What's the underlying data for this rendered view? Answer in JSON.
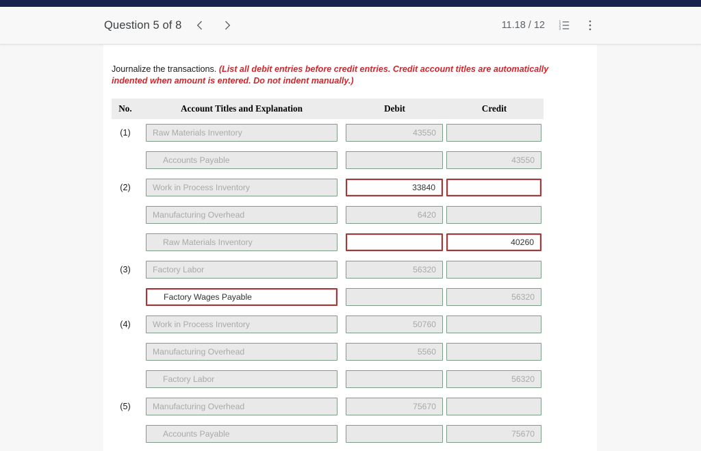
{
  "toolbar": {
    "question_label": "Question 5 of 8",
    "prev_icon": "chevron-left-icon",
    "next_icon": "chevron-right-icon",
    "score": "11.18 / 12",
    "list_icon": "numbered-list-icon",
    "more_icon": "more-vertical-icon"
  },
  "instructions": {
    "plain": "Journalize the transactions.",
    "emphasis": "(List all debit entries before credit entries. Credit account titles are automatically indented when amount is entered. Do not indent manually.)"
  },
  "table": {
    "headers": {
      "no": "No.",
      "account": "Account Titles and Explanation",
      "debit": "Debit",
      "credit": "Credit"
    },
    "rows": [
      {
        "no": "(1)",
        "lines": [
          {
            "account": "Raw Materials Inventory",
            "indent": false,
            "account_state": "disabled",
            "debit": "43550",
            "debit_state": "disabled",
            "credit": "",
            "credit_state": "disabled"
          },
          {
            "account": "Accounts Payable",
            "indent": true,
            "account_state": "disabled",
            "debit": "",
            "debit_state": "disabled",
            "credit": "43550",
            "credit_state": "disabled"
          }
        ]
      },
      {
        "no": "(2)",
        "lines": [
          {
            "account": "Work in Process Inventory",
            "indent": false,
            "account_state": "disabled",
            "debit": "33840",
            "debit_state": "active",
            "credit": "",
            "credit_state": "active"
          },
          {
            "account": "Manufacturing Overhead",
            "indent": false,
            "account_state": "disabled",
            "debit": "6420",
            "debit_state": "disabled",
            "credit": "",
            "credit_state": "disabled"
          },
          {
            "account": "Raw Materials Inventory",
            "indent": true,
            "account_state": "disabled",
            "debit": "",
            "debit_state": "active",
            "credit": "40260",
            "credit_state": "active"
          }
        ]
      },
      {
        "no": "(3)",
        "lines": [
          {
            "account": "Factory Labor",
            "indent": false,
            "account_state": "disabled",
            "debit": "56320",
            "debit_state": "disabled",
            "credit": "",
            "credit_state": "disabled"
          },
          {
            "account": "Factory Wages Payable",
            "indent": true,
            "account_state": "active",
            "debit": "",
            "debit_state": "disabled",
            "credit": "56320",
            "credit_state": "disabled"
          }
        ]
      },
      {
        "no": "(4)",
        "lines": [
          {
            "account": "Work in Process Inventory",
            "indent": false,
            "account_state": "disabled",
            "debit": "50760",
            "debit_state": "disabled",
            "credit": "",
            "credit_state": "disabled"
          },
          {
            "account": "Manufacturing Overhead",
            "indent": false,
            "account_state": "disabled",
            "debit": "5560",
            "debit_state": "disabled",
            "credit": "",
            "credit_state": "disabled"
          },
          {
            "account": "Factory Labor",
            "indent": true,
            "account_state": "disabled",
            "debit": "",
            "debit_state": "disabled",
            "credit": "56320",
            "credit_state": "disabled"
          }
        ]
      },
      {
        "no": "(5)",
        "lines": [
          {
            "account": "Manufacturing Overhead",
            "indent": false,
            "account_state": "disabled",
            "debit": "75670",
            "debit_state": "disabled",
            "credit": "",
            "credit_state": "disabled"
          },
          {
            "account": "Accounts Payable",
            "indent": true,
            "account_state": "disabled",
            "debit": "",
            "debit_state": "disabled",
            "credit": "75670",
            "credit_state": "disabled"
          }
        ]
      }
    ]
  },
  "colors": {
    "navy": "#18224a",
    "instruction_red": "#d0262c",
    "field_border": "#7d9c88",
    "active_border": "#9e3a3a",
    "header_bg": "#ececec"
  }
}
